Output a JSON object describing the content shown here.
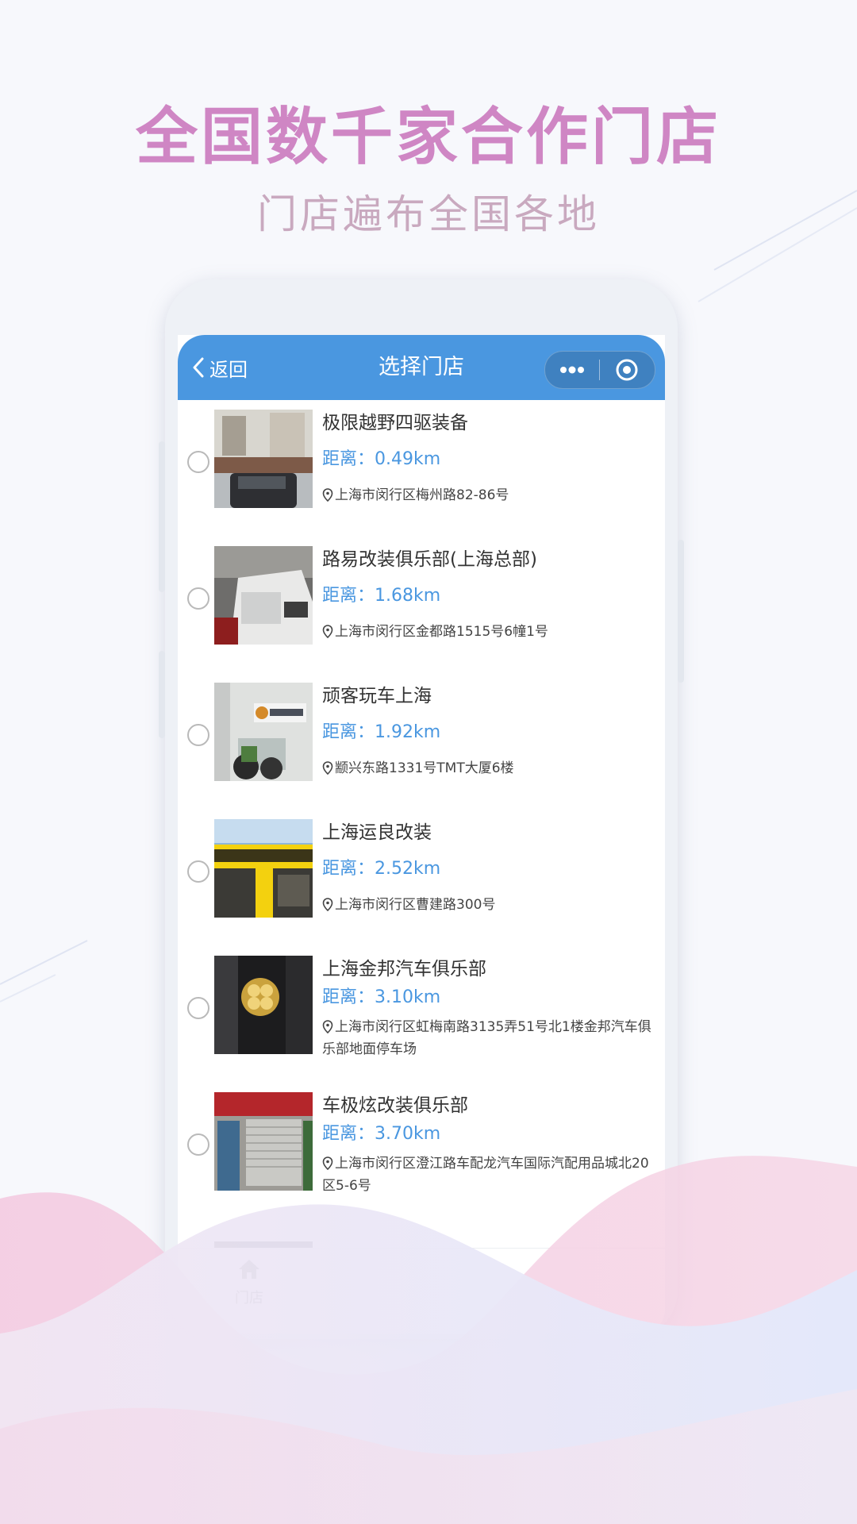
{
  "headline": "全国数千家合作门店",
  "subline": "门店遍布全国各地",
  "colors": {
    "accent": "#4a97e0",
    "headline": "#cf86c4",
    "subline": "#c9a9bf"
  },
  "navbar": {
    "back_label": "返回",
    "title": "选择门店",
    "menu_icon": "more-dots-icon",
    "close_icon": "target-icon"
  },
  "stores": [
    {
      "name": "极限越野四驱装备",
      "distance": "距离：0.49km",
      "address": "上海市闵行区梅州路82-86号"
    },
    {
      "name": "路易改装俱乐部(上海总部)",
      "distance": "距离：1.68km",
      "address": "上海市闵行区金都路1515号6幢1号"
    },
    {
      "name": "顽客玩车上海",
      "distance": "距离：1.92km",
      "address": "颛兴东路1331号TMT大厦6楼"
    },
    {
      "name": "上海运良改装",
      "distance": "距离：2.52km",
      "address": "上海市闵行区曹建路300号"
    },
    {
      "name": "上海金邦汽车俱乐部",
      "distance": "距离：3.10km",
      "address": "上海市闵行区虹梅南路3135弄51号北1楼金邦汽车俱乐部地面停车场"
    },
    {
      "name": "车极炫改装俱乐部",
      "distance": "距离：3.70km",
      "address": "上海市闵行区澄江路车配龙汽车国际汽配用品城北20区5-6号"
    }
  ],
  "tabbar": {
    "home_label": "门店",
    "home_icon": "home-icon"
  }
}
